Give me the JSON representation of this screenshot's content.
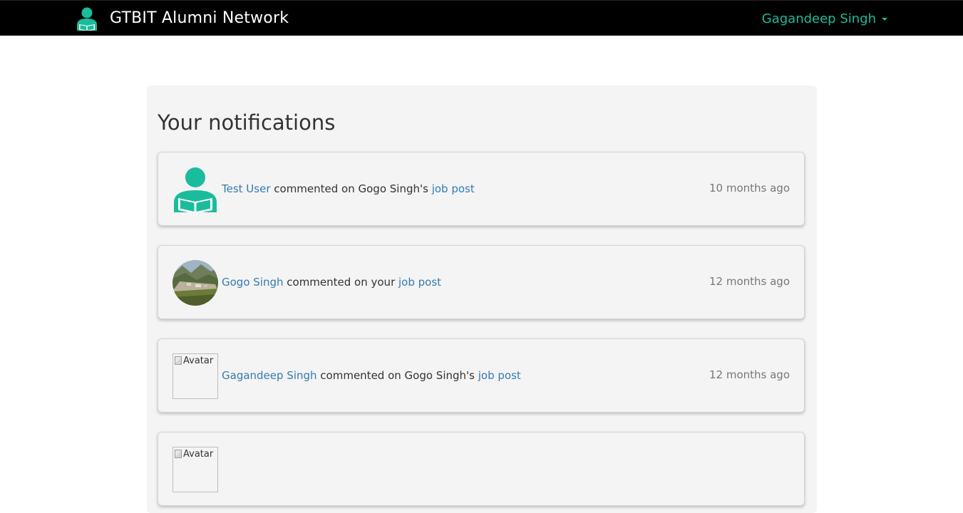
{
  "navbar": {
    "brand_title": "GTBIT Alumni Network",
    "brand_icon": "reader-user-icon",
    "user_name": "Gagandeep Singh",
    "colors": {
      "background": "#000000",
      "accent": "#1abc9c"
    }
  },
  "page": {
    "title": "Your notifications"
  },
  "notifications": [
    {
      "avatar_type": "reader-user-icon",
      "actor": "Test User",
      "action": " commented on Gogo Singh's ",
      "link": "job post",
      "time": "10 months ago"
    },
    {
      "avatar_type": "landscape-photo",
      "actor": "Gogo Singh",
      "action": " commented on your ",
      "link": "job post",
      "time": "12 months ago"
    },
    {
      "avatar_type": "broken-image",
      "avatar_alt": "Avatar",
      "actor": "Gagandeep Singh",
      "action": " commented on Gogo Singh's ",
      "link": "job post",
      "time": "12 months ago"
    },
    {
      "avatar_type": "broken-image",
      "avatar_alt": "Avatar"
    }
  ],
  "colors": {
    "link": "#337ab7",
    "text": "#333333",
    "muted": "#777777",
    "panel": "#f4f4f4"
  }
}
